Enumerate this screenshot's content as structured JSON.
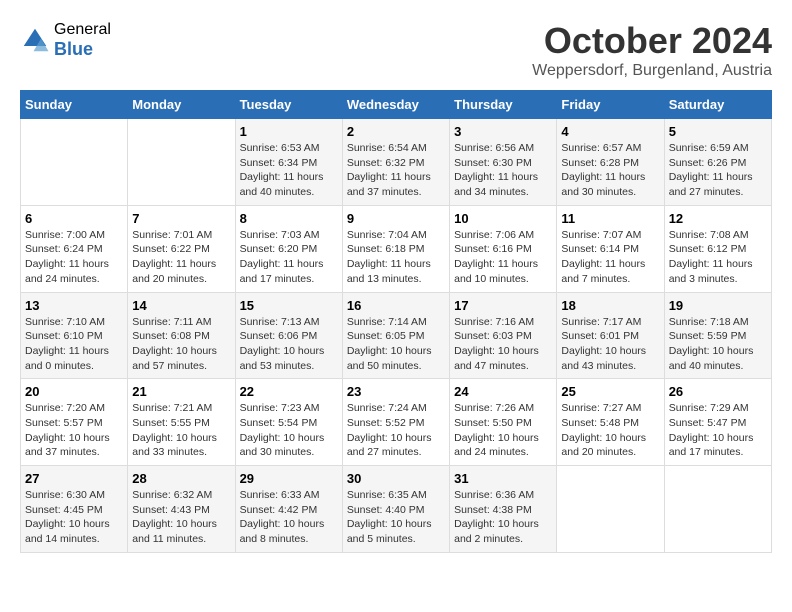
{
  "logo": {
    "general": "General",
    "blue": "Blue"
  },
  "title": "October 2024",
  "location": "Weppersdorf, Burgenland, Austria",
  "weekdays": [
    "Sunday",
    "Monday",
    "Tuesday",
    "Wednesday",
    "Thursday",
    "Friday",
    "Saturday"
  ],
  "weeks": [
    [
      {
        "day": "",
        "info": ""
      },
      {
        "day": "",
        "info": ""
      },
      {
        "day": "1",
        "info": "Sunrise: 6:53 AM\nSunset: 6:34 PM\nDaylight: 11 hours and 40 minutes."
      },
      {
        "day": "2",
        "info": "Sunrise: 6:54 AM\nSunset: 6:32 PM\nDaylight: 11 hours and 37 minutes."
      },
      {
        "day": "3",
        "info": "Sunrise: 6:56 AM\nSunset: 6:30 PM\nDaylight: 11 hours and 34 minutes."
      },
      {
        "day": "4",
        "info": "Sunrise: 6:57 AM\nSunset: 6:28 PM\nDaylight: 11 hours and 30 minutes."
      },
      {
        "day": "5",
        "info": "Sunrise: 6:59 AM\nSunset: 6:26 PM\nDaylight: 11 hours and 27 minutes."
      }
    ],
    [
      {
        "day": "6",
        "info": "Sunrise: 7:00 AM\nSunset: 6:24 PM\nDaylight: 11 hours and 24 minutes."
      },
      {
        "day": "7",
        "info": "Sunrise: 7:01 AM\nSunset: 6:22 PM\nDaylight: 11 hours and 20 minutes."
      },
      {
        "day": "8",
        "info": "Sunrise: 7:03 AM\nSunset: 6:20 PM\nDaylight: 11 hours and 17 minutes."
      },
      {
        "day": "9",
        "info": "Sunrise: 7:04 AM\nSunset: 6:18 PM\nDaylight: 11 hours and 13 minutes."
      },
      {
        "day": "10",
        "info": "Sunrise: 7:06 AM\nSunset: 6:16 PM\nDaylight: 11 hours and 10 minutes."
      },
      {
        "day": "11",
        "info": "Sunrise: 7:07 AM\nSunset: 6:14 PM\nDaylight: 11 hours and 7 minutes."
      },
      {
        "day": "12",
        "info": "Sunrise: 7:08 AM\nSunset: 6:12 PM\nDaylight: 11 hours and 3 minutes."
      }
    ],
    [
      {
        "day": "13",
        "info": "Sunrise: 7:10 AM\nSunset: 6:10 PM\nDaylight: 11 hours and 0 minutes."
      },
      {
        "day": "14",
        "info": "Sunrise: 7:11 AM\nSunset: 6:08 PM\nDaylight: 10 hours and 57 minutes."
      },
      {
        "day": "15",
        "info": "Sunrise: 7:13 AM\nSunset: 6:06 PM\nDaylight: 10 hours and 53 minutes."
      },
      {
        "day": "16",
        "info": "Sunrise: 7:14 AM\nSunset: 6:05 PM\nDaylight: 10 hours and 50 minutes."
      },
      {
        "day": "17",
        "info": "Sunrise: 7:16 AM\nSunset: 6:03 PM\nDaylight: 10 hours and 47 minutes."
      },
      {
        "day": "18",
        "info": "Sunrise: 7:17 AM\nSunset: 6:01 PM\nDaylight: 10 hours and 43 minutes."
      },
      {
        "day": "19",
        "info": "Sunrise: 7:18 AM\nSunset: 5:59 PM\nDaylight: 10 hours and 40 minutes."
      }
    ],
    [
      {
        "day": "20",
        "info": "Sunrise: 7:20 AM\nSunset: 5:57 PM\nDaylight: 10 hours and 37 minutes."
      },
      {
        "day": "21",
        "info": "Sunrise: 7:21 AM\nSunset: 5:55 PM\nDaylight: 10 hours and 33 minutes."
      },
      {
        "day": "22",
        "info": "Sunrise: 7:23 AM\nSunset: 5:54 PM\nDaylight: 10 hours and 30 minutes."
      },
      {
        "day": "23",
        "info": "Sunrise: 7:24 AM\nSunset: 5:52 PM\nDaylight: 10 hours and 27 minutes."
      },
      {
        "day": "24",
        "info": "Sunrise: 7:26 AM\nSunset: 5:50 PM\nDaylight: 10 hours and 24 minutes."
      },
      {
        "day": "25",
        "info": "Sunrise: 7:27 AM\nSunset: 5:48 PM\nDaylight: 10 hours and 20 minutes."
      },
      {
        "day": "26",
        "info": "Sunrise: 7:29 AM\nSunset: 5:47 PM\nDaylight: 10 hours and 17 minutes."
      }
    ],
    [
      {
        "day": "27",
        "info": "Sunrise: 6:30 AM\nSunset: 4:45 PM\nDaylight: 10 hours and 14 minutes."
      },
      {
        "day": "28",
        "info": "Sunrise: 6:32 AM\nSunset: 4:43 PM\nDaylight: 10 hours and 11 minutes."
      },
      {
        "day": "29",
        "info": "Sunrise: 6:33 AM\nSunset: 4:42 PM\nDaylight: 10 hours and 8 minutes."
      },
      {
        "day": "30",
        "info": "Sunrise: 6:35 AM\nSunset: 4:40 PM\nDaylight: 10 hours and 5 minutes."
      },
      {
        "day": "31",
        "info": "Sunrise: 6:36 AM\nSunset: 4:38 PM\nDaylight: 10 hours and 2 minutes."
      },
      {
        "day": "",
        "info": ""
      },
      {
        "day": "",
        "info": ""
      }
    ]
  ]
}
